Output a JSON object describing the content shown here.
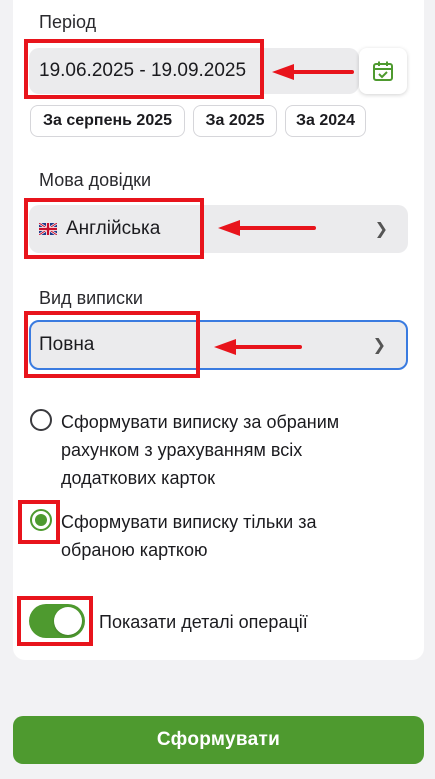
{
  "period": {
    "label": "Період",
    "value": "19.06.2025 - 19.09.2025",
    "calendar_icon": "calendar-check-icon",
    "quick_ranges": [
      "За серпень 2025",
      "За 2025",
      "За 2024"
    ]
  },
  "language": {
    "label": "Мова довідки",
    "flag_icon": "uk-flag-icon",
    "value": "Англійська"
  },
  "statement_type": {
    "label": "Вид виписки",
    "value": "Повна"
  },
  "options": {
    "radio_all": "Сформувати виписку за обраним рахунком з урахуванням всіх додаткових карток",
    "radio_selected": "Сформувати виписку тільки за обраною карткою",
    "selected": "radio_selected"
  },
  "details_toggle": {
    "label": "Показати деталі операції",
    "on": true
  },
  "submit": {
    "label": "Сформувати"
  },
  "colors": {
    "accent": "#4e9a2f",
    "annotation": "#e8141c",
    "focus": "#3a7be0"
  }
}
